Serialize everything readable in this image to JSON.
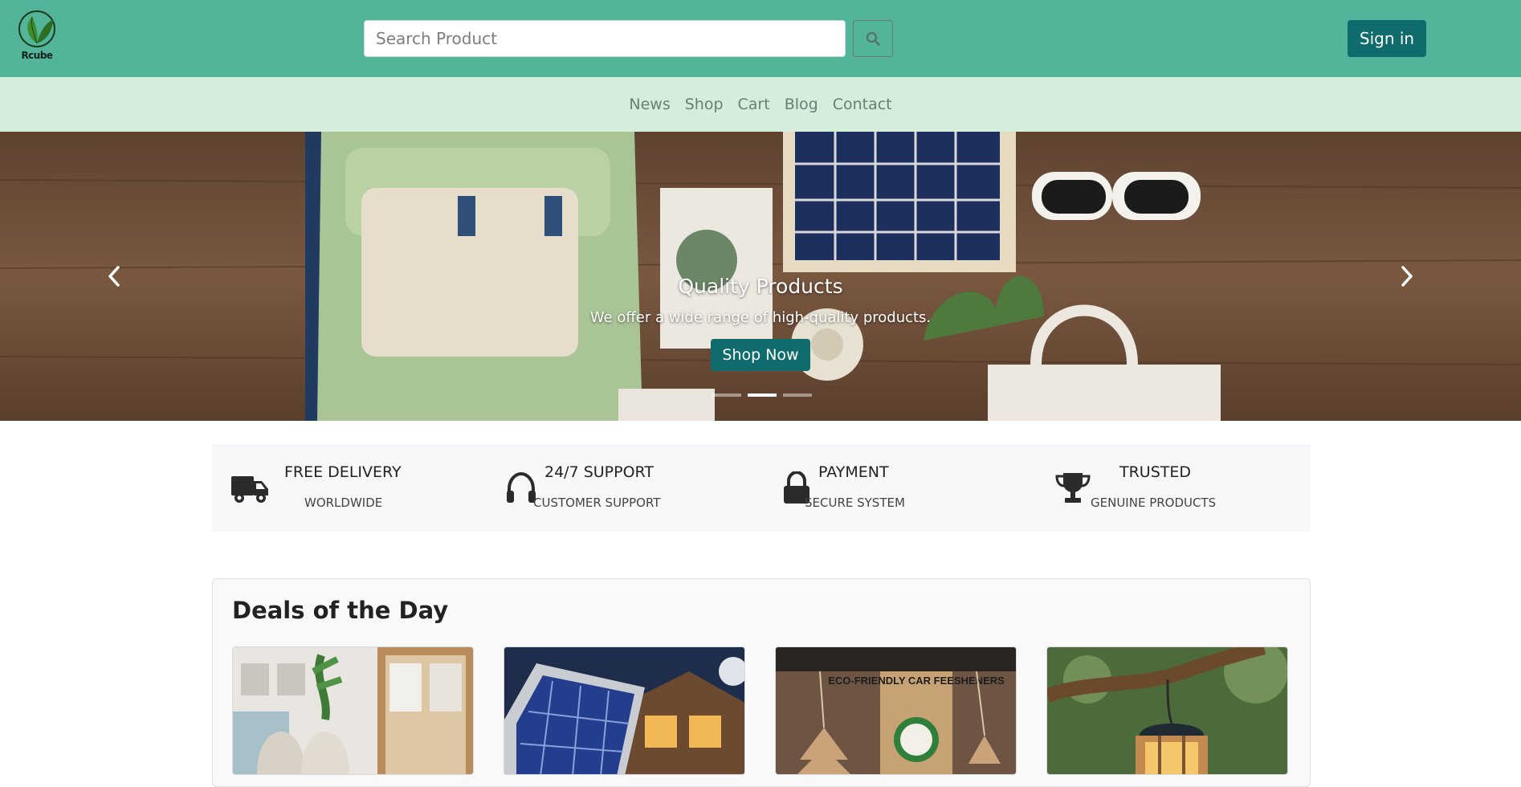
{
  "header": {
    "logo_text": "Rcube",
    "search_placeholder": "Search Product",
    "search_icon": "search-icon",
    "signin_label": "Sign in"
  },
  "nav": {
    "items": [
      "News",
      "Shop",
      "Cart",
      "Blog",
      "Contact"
    ]
  },
  "hero": {
    "title": "Quality Products",
    "subtitle": "We offer a wide range of high-quality products.",
    "button_label": "Shop Now",
    "prev_icon": "chevron-left-icon",
    "next_icon": "chevron-right-icon",
    "slide_count": 3,
    "active_slide": 2
  },
  "features": [
    {
      "icon": "truck-icon",
      "title": "FREE DELIVERY",
      "subtitle": "WORLDWIDE"
    },
    {
      "icon": "headphones-icon",
      "title": "24/7 SUPPORT",
      "subtitle": "CUSTOMER SUPPORT"
    },
    {
      "icon": "lock-icon",
      "title": "PAYMENT",
      "subtitle": "SECURE SYSTEM"
    },
    {
      "icon": "trophy-icon",
      "title": "TRUSTED",
      "subtitle": "GENUINE PRODUCTS"
    }
  ],
  "deals": {
    "title": "Deals of the Day",
    "products": [
      {
        "image": "fabric-sachets-image"
      },
      {
        "image": "solar-panel-light-image"
      },
      {
        "image": "car-freshener-image",
        "text": "ECO-FRIENDLY CAR FEESHENERS"
      },
      {
        "image": "solar-lantern-image"
      }
    ]
  },
  "colors": {
    "header_bg": "#52b59a",
    "nav_bg": "#d5eedb",
    "accent": "#0f6b6c"
  }
}
